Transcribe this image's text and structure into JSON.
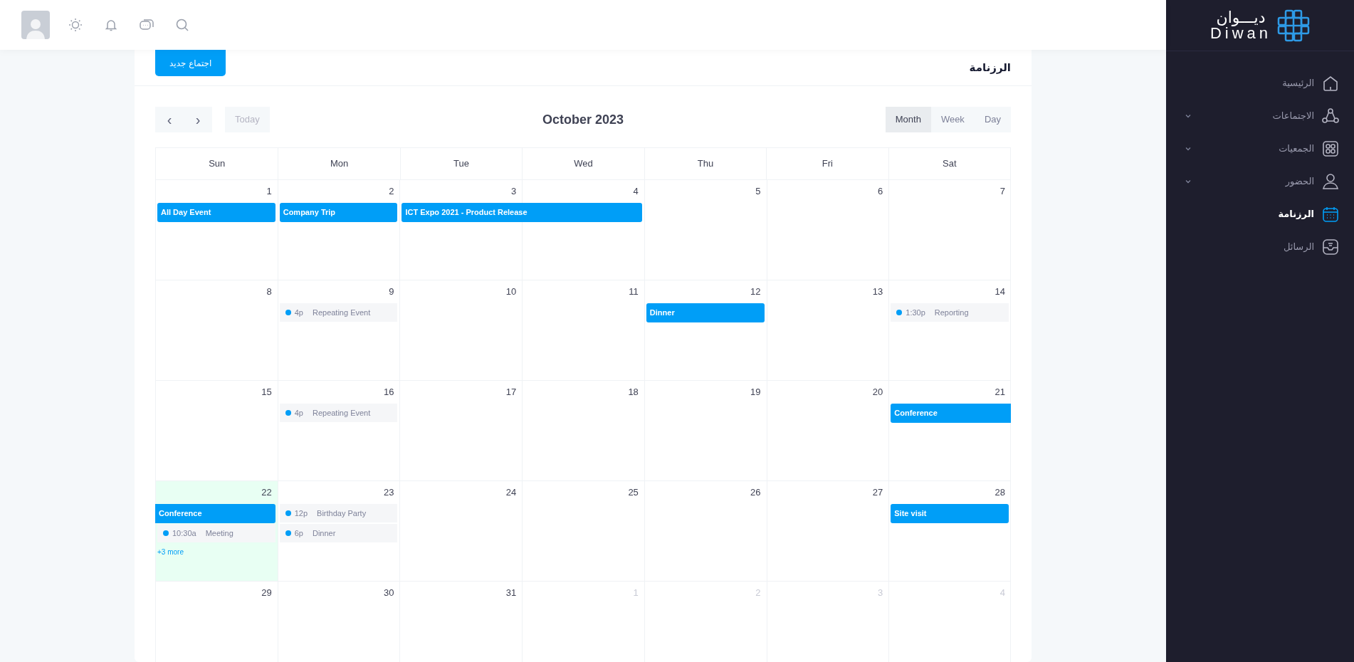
{
  "logo": {
    "arabic": "ديـــوان",
    "latin": "Diwan"
  },
  "sidebar": {
    "items": [
      {
        "label": "الرئيسية",
        "expandable": false,
        "selected": false
      },
      {
        "label": "الاجتماعات",
        "expandable": true,
        "selected": false
      },
      {
        "label": "الجمعيات",
        "expandable": true,
        "selected": false
      },
      {
        "label": "الحضور",
        "expandable": true,
        "selected": false
      },
      {
        "label": "الرزنامة",
        "expandable": false,
        "selected": true
      },
      {
        "label": "الرسائل",
        "expandable": false,
        "selected": false
      }
    ]
  },
  "card": {
    "title": "الرزنامة",
    "new_button": "اجتماع جديد"
  },
  "calendar": {
    "prev": "‹",
    "next": "›",
    "today_button": {
      "label": "Today",
      "disabled": true
    },
    "title": "October 2023",
    "views": [
      {
        "label": "Month",
        "selected": true
      },
      {
        "label": "Week",
        "selected": false
      },
      {
        "label": "Day",
        "selected": false
      }
    ],
    "weekdays": [
      "Sun",
      "Mon",
      "Tue",
      "Wed",
      "Thu",
      "Fri",
      "Sat"
    ],
    "weeks": [
      {
        "days": [
          {
            "number": "1",
            "other_month": false,
            "today": false,
            "events": [
              {
                "kind": "bar",
                "title": "All Day Event",
                "spans_next_day": false,
                "continues_left": false
              }
            ]
          },
          {
            "number": "2",
            "other_month": false,
            "today": false,
            "events": [
              {
                "kind": "bar",
                "title": "Company Trip",
                "spans_next_day": false,
                "continues_left": false
              }
            ]
          },
          {
            "number": "3",
            "other_month": false,
            "today": false,
            "events": [
              {
                "kind": "bar",
                "title": "ICT Expo 2021 - Product Release",
                "spans_next_day": true,
                "continues_left": false
              }
            ]
          },
          {
            "number": "4",
            "other_month": false,
            "today": false
          },
          {
            "number": "5",
            "other_month": false,
            "today": false
          },
          {
            "number": "6",
            "other_month": false,
            "today": false
          },
          {
            "number": "7",
            "other_month": false,
            "today": false
          }
        ]
      },
      {
        "days": [
          {
            "number": "8",
            "other_month": false,
            "today": false
          },
          {
            "number": "9",
            "other_month": false,
            "today": false,
            "events": [
              {
                "kind": "dot",
                "time": "4p",
                "title": "Repeating Event"
              }
            ]
          },
          {
            "number": "10",
            "other_month": false,
            "today": false
          },
          {
            "number": "11",
            "other_month": false,
            "today": false
          },
          {
            "number": "12",
            "other_month": false,
            "today": false,
            "events": [
              {
                "kind": "bar",
                "title": "Dinner",
                "spans_next_day": false,
                "continues_left": false
              }
            ]
          },
          {
            "number": "13",
            "other_month": false,
            "today": false
          },
          {
            "number": "14",
            "other_month": false,
            "today": false,
            "events": [
              {
                "kind": "dot",
                "time": "1:30p",
                "title": "Reporting"
              }
            ]
          }
        ]
      },
      {
        "days": [
          {
            "number": "15",
            "other_month": false,
            "today": false
          },
          {
            "number": "16",
            "other_month": false,
            "today": false,
            "events": [
              {
                "kind": "dot",
                "time": "4p",
                "title": "Repeating Event"
              }
            ]
          },
          {
            "number": "17",
            "other_month": false,
            "today": false
          },
          {
            "number": "18",
            "other_month": false,
            "today": false
          },
          {
            "number": "19",
            "other_month": false,
            "today": false
          },
          {
            "number": "20",
            "other_month": false,
            "today": false
          },
          {
            "number": "21",
            "other_month": false,
            "today": false,
            "events": [
              {
                "kind": "bar",
                "title": "Conference",
                "spans_next_day": true,
                "continues_left": false
              }
            ]
          }
        ]
      },
      {
        "days": [
          {
            "number": "22",
            "other_month": false,
            "today": true,
            "events": [
              {
                "kind": "bar",
                "title": "Conference",
                "spans_next_day": false,
                "continues_left": true
              },
              {
                "kind": "dot",
                "time": "10:30a",
                "title": "Meeting"
              }
            ],
            "more": "+3 more"
          },
          {
            "number": "23",
            "other_month": false,
            "today": false,
            "events": [
              {
                "kind": "dot",
                "time": "12p",
                "title": "Birthday Party"
              },
              {
                "kind": "dot",
                "time": "6p",
                "title": "Dinner"
              }
            ]
          },
          {
            "number": "24",
            "other_month": false,
            "today": false
          },
          {
            "number": "25",
            "other_month": false,
            "today": false
          },
          {
            "number": "26",
            "other_month": false,
            "today": false
          },
          {
            "number": "27",
            "other_month": false,
            "today": false
          },
          {
            "number": "28",
            "other_month": false,
            "today": false,
            "events": [
              {
                "kind": "bar",
                "title": "Site visit",
                "spans_next_day": false,
                "continues_left": false
              }
            ]
          }
        ]
      },
      {
        "days": [
          {
            "number": "29",
            "other_month": false,
            "today": false
          },
          {
            "number": "30",
            "other_month": false,
            "today": false
          },
          {
            "number": "31",
            "other_month": false,
            "today": false
          },
          {
            "number": "1",
            "other_month": true,
            "today": false
          },
          {
            "number": "2",
            "other_month": true,
            "today": false
          },
          {
            "number": "3",
            "other_month": true,
            "today": false
          },
          {
            "number": "4",
            "other_month": true,
            "today": false
          }
        ]
      }
    ]
  }
}
